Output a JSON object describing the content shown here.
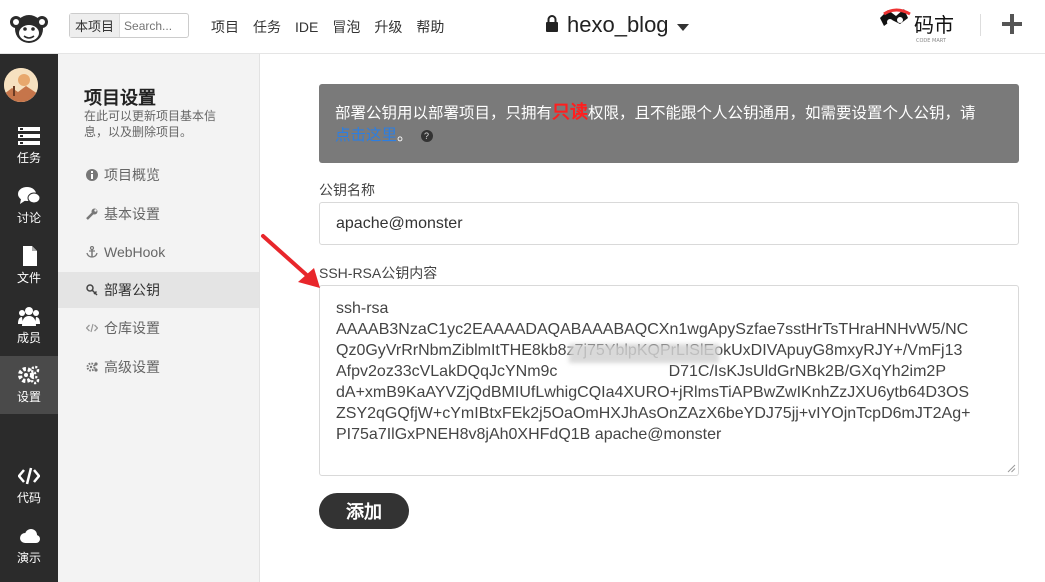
{
  "topbar": {
    "search_scope": "本项目",
    "search_placeholder": "Search...",
    "nav": [
      "项目",
      "任务",
      "IDE",
      "冒泡",
      "升级",
      "帮助"
    ],
    "project_title": "hexo_blog",
    "brand_text": "码市",
    "brand_sub": "CODE MART"
  },
  "sidebar": {
    "items": [
      {
        "label": "任务",
        "icon": "tasks-icon"
      },
      {
        "label": "讨论",
        "icon": "chat-icon"
      },
      {
        "label": "文件",
        "icon": "file-icon"
      },
      {
        "label": "成员",
        "icon": "members-icon"
      },
      {
        "label": "设置",
        "icon": "gear-icon",
        "active": true
      },
      {
        "label": "代码",
        "icon": "code-icon"
      },
      {
        "label": "演示",
        "icon": "cloud-icon"
      }
    ]
  },
  "subnav": {
    "title": "项目设置",
    "desc": "在此可以更新项目基本信息，以及删除项目。",
    "items": [
      {
        "label": "项目概览",
        "icon": "info-icon"
      },
      {
        "label": "基本设置",
        "icon": "wrench-icon"
      },
      {
        "label": "WebHook",
        "icon": "anchor-icon"
      },
      {
        "label": "部署公钥",
        "icon": "key-icon",
        "active": true
      },
      {
        "label": "仓库设置",
        "icon": "code-icon"
      },
      {
        "label": "高级设置",
        "icon": "cogs-icon"
      }
    ]
  },
  "notice": {
    "text_before": "部署公钥用以部署项目，只拥有",
    "highlight": "只读",
    "text_after": "权限，且不能跟个人公钥通用，如需要设置个人公钥，请",
    "link": "点击这里",
    "end": "。"
  },
  "form": {
    "name_label": "公钥名称",
    "name_value": "apache@monster",
    "key_label": "SSH-RSA公钥内容",
    "key_lines": [
      "ssh-rsa",
      "AAAAB3NzaC1yc2EAAAADAQABAAABAQCXn1wgApySzfae7sstHrTsTHraHNHvW5/NC",
      "Qz0GyVrRrNbmZiblmItTHE8kb8z7j75YblpKQPrLISlEokUxDIVApuyG8mxyRJY+/VmFj13",
      "Afpv2oz33cVLakDQqJcYNm9c                         D71C/IsKJsUldGrNBk2B/GXqYh2im2P",
      "dA+xmB9KaAYVZjQdBMIUfLwhigCQIa4XURO+jRlmsTiAPBwZwIKnhZzJXU6ytb64D3OS",
      "ZSY2qGQfjW+cYmIBtxFEk2j5OaOmHXJhAsOnZAzX6beYDJ75jj+vIYOjnTcpD6mJT2Ag+",
      "PI75a7IlGxPNEH8v8jAh0XHFdQ1B apache@monster"
    ],
    "submit_label": "添加"
  }
}
